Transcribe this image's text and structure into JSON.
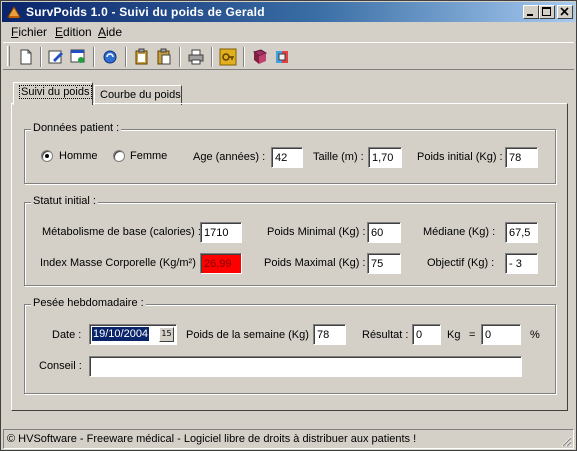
{
  "window": {
    "title": "SurvPoids 1.0 - Suivi du poids de Gerald",
    "controls": [
      "minimize",
      "maximize",
      "close"
    ]
  },
  "menu": [
    {
      "label": "Fichier",
      "accel": "F"
    },
    {
      "label": "Edition",
      "accel": "E"
    },
    {
      "label": "Aide",
      "accel": "A"
    }
  ],
  "toolbar": {
    "icons": [
      "new-document-icon",
      "edit-icon",
      "open-window-icon",
      "refresh-icon",
      "paste-icon",
      "paste-special-icon",
      "print-icon",
      "key-icon",
      "book-icon",
      "help-icon"
    ]
  },
  "tabs": [
    {
      "label": "Suivi du poids",
      "active": true
    },
    {
      "label": "Courbe du poids",
      "active": false
    }
  ],
  "patient": {
    "group_label": "Données patient :",
    "sex_options": [
      {
        "label": "Homme",
        "selected": true
      },
      {
        "label": "Femme",
        "selected": false
      }
    ],
    "age_label": "Age (années) :",
    "age_value": "42",
    "height_label": "Taille (m) :",
    "height_value": "1,70",
    "initial_weight_label": "Poids initial (Kg) :",
    "initial_weight_value": "78"
  },
  "status": {
    "group_label": "Statut initial :",
    "metabolism_label": "Métabolisme de base (calories) :",
    "metabolism_value": "1710",
    "min_weight_label": "Poids Minimal (Kg) :",
    "min_weight_value": "60",
    "median_label": "Médiane (Kg) :",
    "median_value": "67,5",
    "bmi_label": "Index Masse Corporelle (Kg/m²) :",
    "bmi_value": "26,99",
    "bmi_color": "#ff0000",
    "max_weight_label": "Poids Maximal (Kg) :",
    "max_weight_value": "75",
    "goal_label": "Objectif (Kg) :",
    "goal_value": "- 3"
  },
  "weekly": {
    "group_label": "Pesée hebdomadaire :",
    "date_label": "Date :",
    "date_value": "19/10/2004",
    "calendar_button": "15",
    "week_weight_label": "Poids de la semaine (Kg) :",
    "week_weight_value": "78",
    "result_label": "Résultat :",
    "result_value": "0",
    "kg_label": "Kg",
    "equals_label": "=",
    "percent_value": "0",
    "percent_label": "%",
    "advice_label": "Conseil :",
    "advice_value": ""
  },
  "statusbar": {
    "text": "© HVSoftware - Freeware médical - Logiciel libre de droits à distribuer aux patients !"
  },
  "colors": {
    "titlebar_start": "#0a246a",
    "titlebar_end": "#a6caf0",
    "face": "#d4d0c8",
    "selection": "#0a246a",
    "alert": "#ff0000"
  }
}
